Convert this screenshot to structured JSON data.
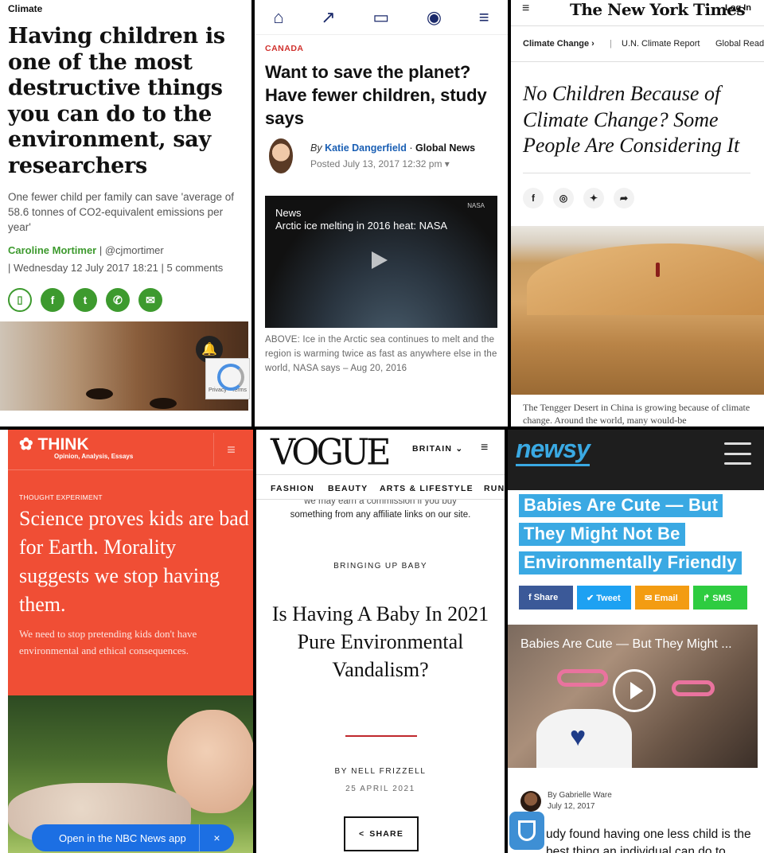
{
  "panel_independent": {
    "section": "Climate",
    "headline": "Having children is one of the most destructive things you can do to the environment, say researchers",
    "standfirst": "One fewer child per family can save 'average of 58.6 tonnes of CO2-equivalent emissions per year'",
    "author_name": "Caroline Mortimer",
    "author_handle": "| @cjmortimer",
    "meta": "| Wednesday 12 July 2017 18:21 |  5 comments",
    "share_icons": [
      "bookmark-icon",
      "facebook-icon",
      "twitter-icon",
      "whatsapp-icon",
      "email-icon"
    ],
    "captcha_text": "Privacy - Terms"
  },
  "panel_globalnews": {
    "nav_icons": [
      "home-icon",
      "trending-icon",
      "tv-icon",
      "location-icon",
      "menu-icon"
    ],
    "category": "CANADA",
    "headline": "Want to save the planet? Have fewer children, study says",
    "by_prefix": "By",
    "author": "Katie Dangerfield",
    "separator": "·",
    "outlet": "Global News",
    "posted": "Posted July 13, 2017 12:32 pm ▾",
    "video_tag": "News",
    "video_title": "Arctic ice melting in 2016 heat: NASA",
    "video_source": "NASA",
    "caption": "ABOVE: Ice in the Arctic sea continues to melt and the region is warming twice as fast as anywhere else in the world, NASA says – Aug 20, 2016"
  },
  "panel_nyt": {
    "logo": "The New York Times",
    "login": "Log In",
    "subnav": [
      "Climate Change ›",
      "|",
      "U.N. Climate Report",
      "Global Read"
    ],
    "headline": "No Children Because of Climate Change? Some People Are Considering It",
    "social": [
      "f",
      "◎",
      "✦",
      "➦"
    ],
    "caption": "The Tengger Desert in China is growing because of climate change. Around the world, many would-be"
  },
  "panel_think": {
    "logo": "THINK",
    "logo_sub": "Opinion, Analysis, Essays",
    "kicker": "THOUGHT EXPERIMENT",
    "headline": "Science proves kids are bad for Earth. Morality suggests we stop having them.",
    "dek": "We need to stop pretending kids don't have environmental and ethical consequences.",
    "app_prompt": "Open in the NBC News app",
    "close": "×"
  },
  "panel_vogue": {
    "logo": "VOGUE",
    "edition": "BRITAIN",
    "nav": [
      "FASHION",
      "BEAUTY",
      "ARTS & LIFESTYLE",
      "RUN"
    ],
    "disclaimer_cut": "we may earn a commission if you buy",
    "disclaimer": "something from any affiliate links on our site.",
    "kicker": "BRINGING UP BABY",
    "headline": "Is Having A Baby In 2021 Pure Environmental Vandalism?",
    "byline": "BY NELL FRIZZELL",
    "date": "25 APRIL 2021",
    "share": "SHARE"
  },
  "panel_newsy": {
    "logo": "newsy",
    "headline_lines": [
      "Babies Are Cute — But",
      "They Might Not Be",
      "Environmentally Friendly"
    ],
    "shares": [
      {
        "label": "f  Share",
        "color": "#3b5998"
      },
      {
        "label": "✔  Tweet",
        "color": "#1da1f2"
      },
      {
        "label": "✉  Email",
        "color": "#f39c12"
      },
      {
        "label": "↱  SMS",
        "color": "#2ecc40"
      }
    ],
    "video_title": "Babies Are Cute — But They Might ...",
    "author": "By Gabrielle Ware",
    "date": "July 12, 2017",
    "body": "udy found having one less child is the best thing an individual can do to"
  }
}
